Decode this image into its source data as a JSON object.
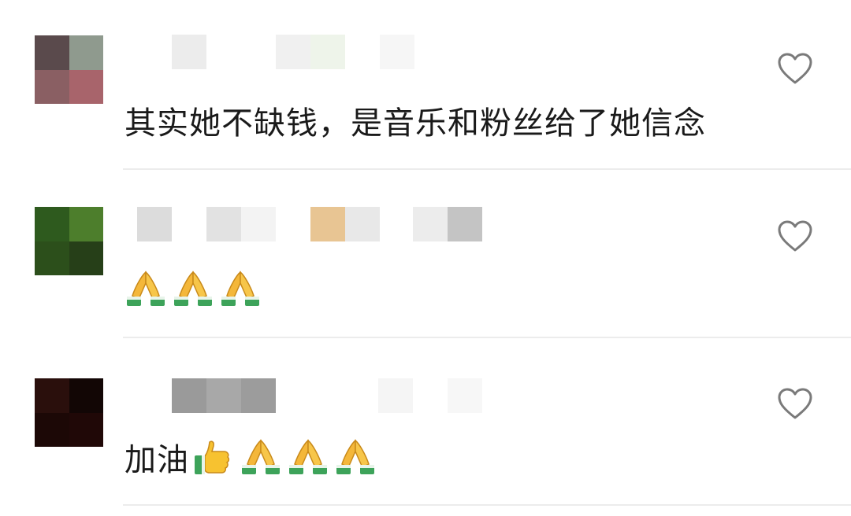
{
  "comments": [
    {
      "author_hidden": true,
      "text": "其实她不缺钱，是音乐和粉丝给了她信念",
      "emojis": [],
      "avatar_colors": [
        "#5a4a4c",
        "#8f9a8e",
        "#8a5f63",
        "#a8646b"
      ],
      "name_mosaic_colors": [
        "#ececec",
        "#f0f0f0",
        "#eef4ea",
        "#f6f6f6"
      ]
    },
    {
      "author_hidden": true,
      "text": "",
      "emojis": [
        "folded-hands",
        "folded-hands",
        "folded-hands"
      ],
      "avatar_colors": [
        "#2e5a1e",
        "#4d7e2c",
        "#2c4f1b",
        "#263f18"
      ],
      "name_mosaic_colors": [
        "#dcdcdc",
        "#e2e2e2",
        "#f3f3f3",
        "#e8c593",
        "#e8e8e8",
        "#ececec",
        "#c4c4c4"
      ]
    },
    {
      "author_hidden": true,
      "text": "加油",
      "emojis": [
        "thumbs-up",
        "folded-hands",
        "folded-hands",
        "folded-hands"
      ],
      "avatar_colors": [
        "#2a0f0c",
        "#120605",
        "#1c0806",
        "#200807"
      ],
      "name_mosaic_colors": [
        "#9a9a9a",
        "#a8a8a8",
        "#9c9c9c",
        "#f5f5f5",
        "#f7f7f7"
      ]
    }
  ],
  "icons": {
    "like": "heart-outline-icon",
    "folded_hands": "folded-hands-emoji",
    "thumbs_up": "thumbs-up-emoji"
  },
  "colors": {
    "divider": "#ececec",
    "heart_stroke": "#7a7a7a",
    "text": "#1a1a1a"
  }
}
